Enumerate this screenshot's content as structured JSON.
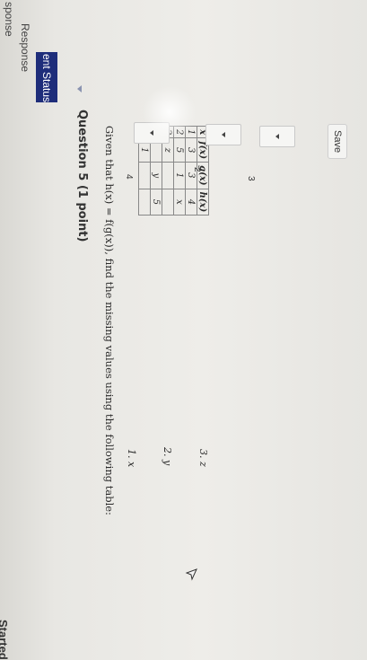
{
  "sidebar": {
    "heading_top": "sponse",
    "heading_sub": "Response",
    "status_label": "ent Status",
    "started_label": "Started"
  },
  "question": {
    "title": "Question 5 (1 point)",
    "prompt": "Given that h(x) = f(g(x)), find the missing values using the following table:"
  },
  "table": {
    "headers": [
      "x",
      "f(x)",
      "g(x)",
      "h(x)"
    ],
    "rows": [
      [
        "1",
        "3",
        "3",
        "4"
      ],
      [
        "2",
        "5",
        "1",
        "x"
      ],
      [
        "3",
        "z",
        "",
        ""
      ],
      [
        "4",
        "",
        "y",
        "5"
      ],
      [
        "5",
        "1",
        "",
        ""
      ]
    ]
  },
  "dropdowns": [
    {
      "number": "4"
    },
    {
      "number": "2"
    },
    {
      "number": "3"
    }
  ],
  "answers": [
    {
      "label": "1. x"
    },
    {
      "label": "2. y"
    },
    {
      "label": "3. z"
    }
  ],
  "actions": {
    "save_label": "Save"
  },
  "colors": {
    "sidebar_accent": "#1e2d7a",
    "page_bg": "#eceae6"
  }
}
